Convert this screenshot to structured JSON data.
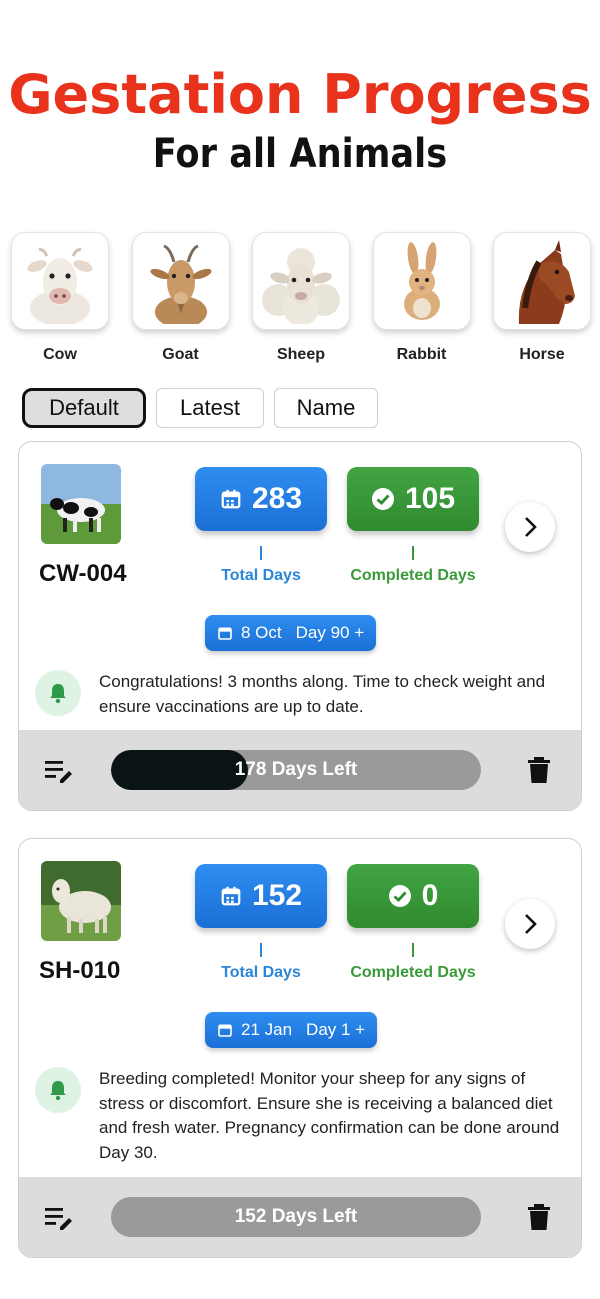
{
  "header": {
    "title": "Gestation Progress",
    "subtitle": "For all Animals"
  },
  "animals": [
    {
      "name": "Cow",
      "icon": "cow-icon"
    },
    {
      "name": "Goat",
      "icon": "goat-icon"
    },
    {
      "name": "Sheep",
      "icon": "sheep-icon"
    },
    {
      "name": "Rabbit",
      "icon": "rabbit-icon"
    },
    {
      "name": "Horse",
      "icon": "horse-icon"
    }
  ],
  "sort": {
    "options": [
      "Default",
      "Latest",
      "Name"
    ],
    "selected": "Default"
  },
  "colors": {
    "title_red": "#e8321c",
    "blue": "#1a6fd6",
    "green": "#2e8b2e",
    "progress_fill": "#0b1414",
    "progress_track": "#9a9a9a"
  },
  "cards": [
    {
      "id": "CW-004",
      "photo": "cow-photo",
      "total_days": "283",
      "total_days_label": "Total Days",
      "completed_days": "105",
      "completed_days_label": "Completed Days",
      "date": "8 Oct",
      "day": "Day 90 +",
      "note": "Congratulations! 3 months along. Time to check weight and ensure vaccinations are up to date.",
      "days_left": "178 Days Left",
      "progress_fraction": 0.37
    },
    {
      "id": "SH-010",
      "photo": "sheep-photo",
      "total_days": "152",
      "total_days_label": "Total Days",
      "completed_days": "0",
      "completed_days_label": "Completed Days",
      "date": "21 Jan",
      "day": "Day 1 +",
      "note": "Breeding completed! Monitor your sheep for any signs of stress or discomfort. Ensure she is receiving a balanced diet and fresh water. Pregnancy confirmation can be done around Day 30.",
      "days_left": "152 Days Left",
      "progress_fraction": 0.0
    }
  ]
}
